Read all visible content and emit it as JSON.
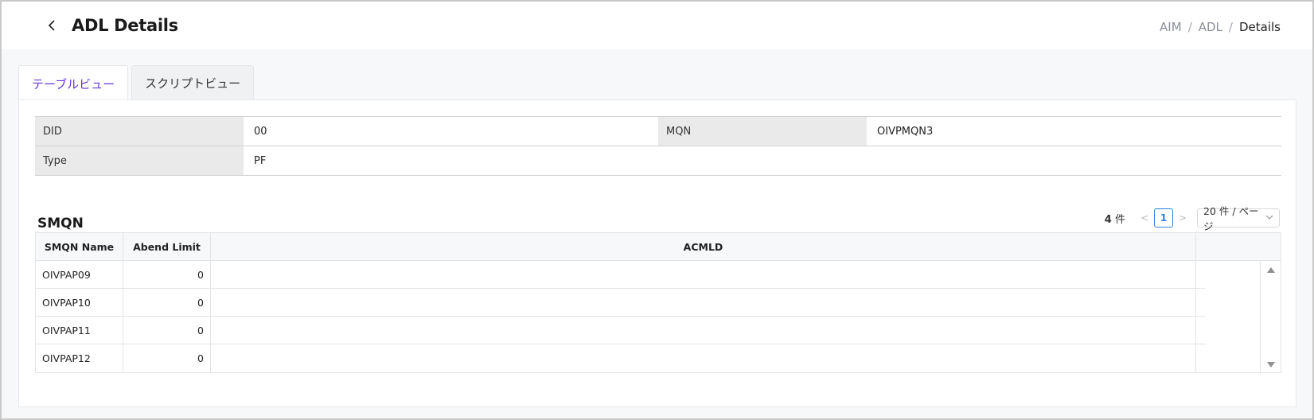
{
  "header": {
    "title": "ADL Details",
    "breadcrumb": [
      "AIM",
      "ADL",
      "Details"
    ],
    "breadcrumb_separator": "/"
  },
  "tabs": [
    {
      "label": "テーブルビュー",
      "active": true
    },
    {
      "label": "スクリプトビュー",
      "active": false
    }
  ],
  "details": {
    "did_label": "DID",
    "did_value": "00",
    "mqn_label": "MQN",
    "mqn_value": "OIVPMQN3",
    "type_label": "Type",
    "type_value": "PF"
  },
  "smqn": {
    "title": "SMQN",
    "pager": {
      "count": "4",
      "count_unit": "件",
      "prev": "<",
      "current_page": "1",
      "next": ">",
      "page_size": "20 件 / ページ"
    },
    "columns": [
      "SMQN Name",
      "Abend Limit",
      "ACMLD"
    ],
    "rows": [
      {
        "name": "OIVPAP09",
        "abend_limit": "0",
        "acmld": ""
      },
      {
        "name": "OIVPAP10",
        "abend_limit": "0",
        "acmld": ""
      },
      {
        "name": "OIVPAP11",
        "abend_limit": "0",
        "acmld": ""
      },
      {
        "name": "OIVPAP12",
        "abend_limit": "0",
        "acmld": ""
      }
    ]
  },
  "colors": {
    "accent": "#6a35d8",
    "pager_active": "#2f7fe0",
    "label_bg": "#eaeaea"
  }
}
